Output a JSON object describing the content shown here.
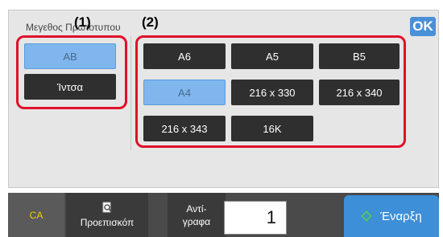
{
  "panel": {
    "title": "Μεγεθος Πρωτοτυπου"
  },
  "ok_label": "OK",
  "callouts": {
    "left": "(1)",
    "right": "(2)"
  },
  "input_types": [
    {
      "label": "AB",
      "selected": true
    },
    {
      "label": "Ίντσα",
      "selected": false
    }
  ],
  "paper_sizes": [
    {
      "label": "A6",
      "selected": false
    },
    {
      "label": "A5",
      "selected": false
    },
    {
      "label": "B5",
      "selected": false
    },
    {
      "label": "A4",
      "selected": true
    },
    {
      "label": "216 x 330",
      "selected": false
    },
    {
      "label": "216 x 340",
      "selected": false
    },
    {
      "label": "216 x 343",
      "selected": false
    },
    {
      "label": "16K",
      "selected": false
    }
  ],
  "bottombar": {
    "ca_label": "CA",
    "preview_label": "Προεπισκόπ",
    "copies_label_1": "Αντί-",
    "copies_label_2": "γραφα",
    "copies_value": "1",
    "start_label": "Έναρξη"
  },
  "colors": {
    "highlight": "#e0102a",
    "selected": "#7fb6ee",
    "accent": "#3d8fd8",
    "ca": "#f0d000"
  },
  "icons": {
    "preview": "magnifier-document-icon",
    "start": "diamond-start-icon"
  }
}
